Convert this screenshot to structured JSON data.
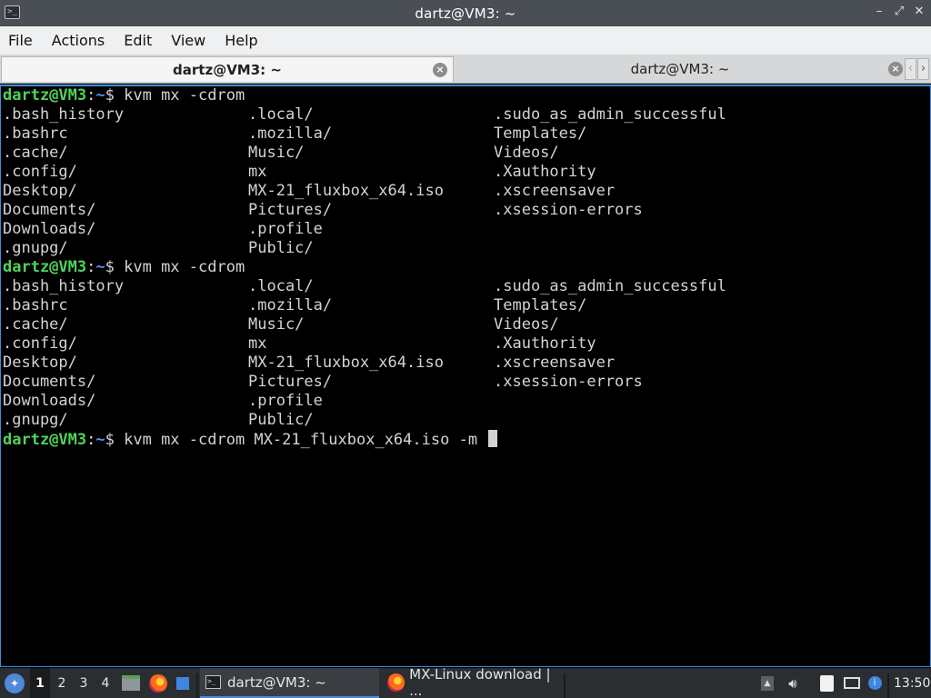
{
  "window": {
    "title": "dartz@VM3: ~",
    "controls": {
      "minimize": "–",
      "maximize": "⤢",
      "close": "✕"
    }
  },
  "menu": [
    "File",
    "Actions",
    "Edit",
    "View",
    "Help"
  ],
  "tabs": [
    {
      "label": "dartz@VM3: ~",
      "active": true
    },
    {
      "label": "dartz@VM3: ~",
      "active": false
    }
  ],
  "colors": {
    "prompt_user": "#4ed45a",
    "prompt_path": "#5e8cf7",
    "terminal_bg": "#000000",
    "terminal_fg": "#d3d3d3",
    "accent": "#3d8ee0"
  },
  "terminal": {
    "prompt": {
      "user_host": "dartz@VM3",
      "separator": ":",
      "path": "~",
      "symbol": "$"
    },
    "commands": [
      "kvm mx -cdrom",
      "kvm mx -cdrom",
      "kvm mx -cdrom MX-21_fluxbox_x64.iso -m"
    ],
    "listing": [
      [
        ".bash_history",
        ".local/",
        ".sudo_as_admin_successful"
      ],
      [
        ".bashrc",
        ".mozilla/",
        "Templates/"
      ],
      [
        ".cache/",
        "Music/",
        "Videos/"
      ],
      [
        ".config/",
        "mx",
        ".Xauthority"
      ],
      [
        "Desktop/",
        "MX-21_fluxbox_x64.iso",
        ".xscreensaver"
      ],
      [
        "Documents/",
        "Pictures/",
        ".xsession-errors"
      ],
      [
        "Downloads/",
        ".profile",
        ""
      ],
      [
        ".gnupg/",
        "Public/",
        ""
      ]
    ]
  },
  "taskbar": {
    "workspaces": [
      "1",
      "2",
      "3",
      "4"
    ],
    "active_workspace": "1",
    "quick_launch": [
      "file-manager-icon",
      "firefox-icon",
      "show-desktop-icon"
    ],
    "tasks": [
      {
        "label": "dartz@VM3: ~",
        "icon": "terminal-icon",
        "active": true
      },
      {
        "label": "MX-Linux download | ...",
        "icon": "firefox-icon",
        "active": false
      }
    ],
    "tray": [
      "updater-icon",
      "volume-icon",
      "clipboard-icon",
      "network-icon",
      "info-icon"
    ],
    "clock": "13:50"
  }
}
